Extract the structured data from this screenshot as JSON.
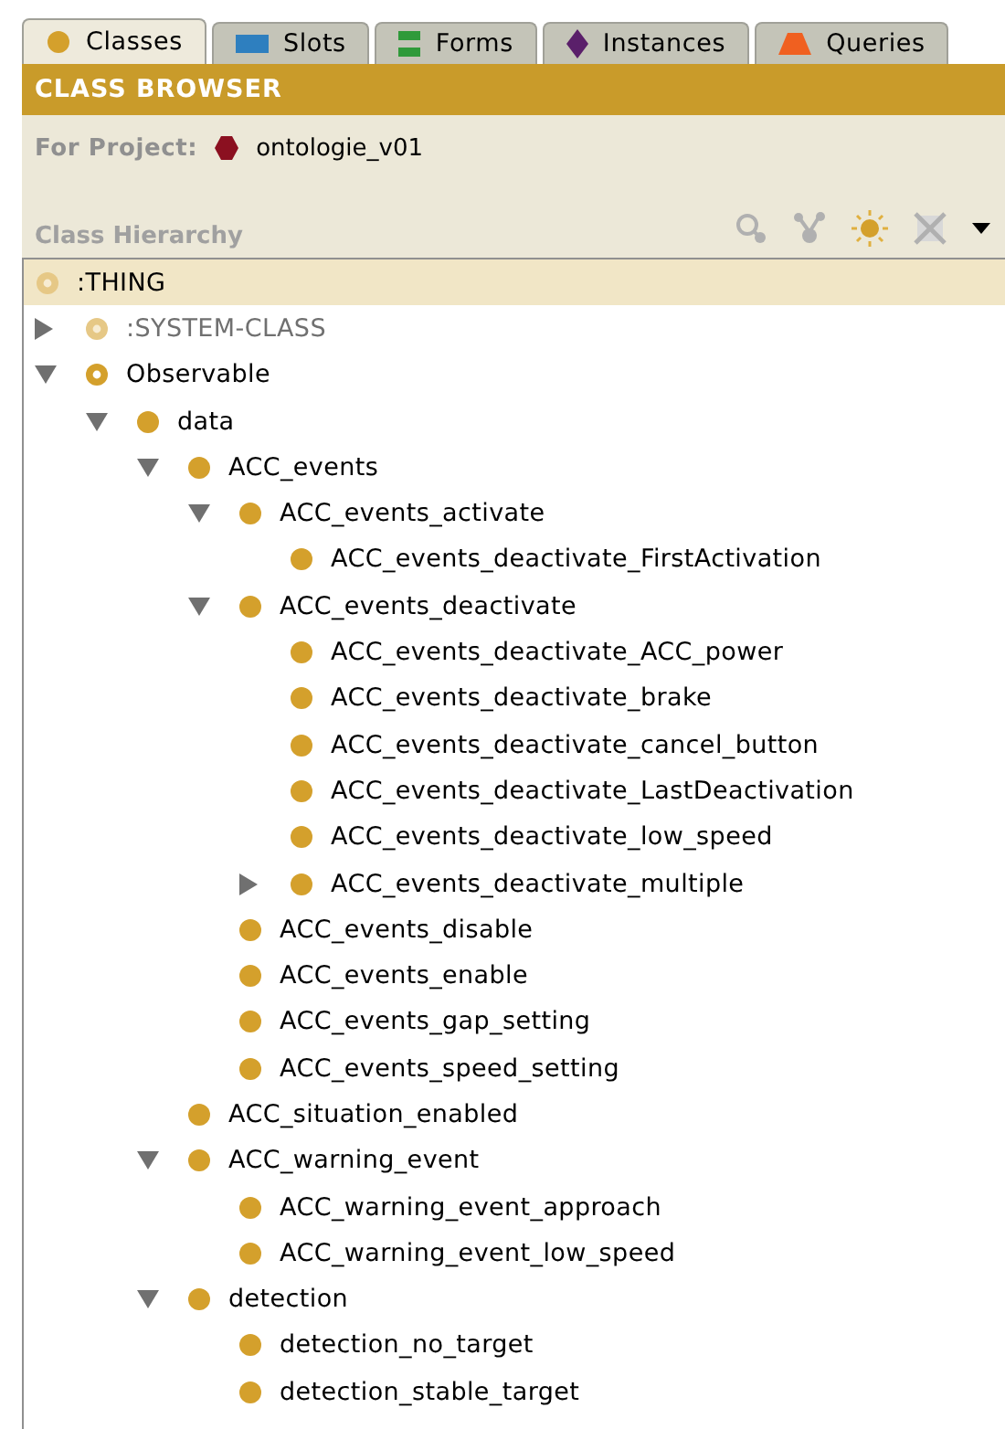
{
  "tabs": [
    {
      "label": "Classes",
      "kind": "class",
      "selected": true
    },
    {
      "label": "Slots",
      "kind": "slot",
      "selected": false
    },
    {
      "label": "Forms",
      "kind": "form",
      "selected": false
    },
    {
      "label": "Instances",
      "kind": "instance",
      "selected": false
    },
    {
      "label": "Queries",
      "kind": "query",
      "selected": false
    }
  ],
  "browser": {
    "title": "CLASS BROWSER",
    "project_label": "For Project:",
    "project_name": "ontologie_v01",
    "hierarchy_label": "Class Hierarchy"
  },
  "tree": {
    "root": {
      "label": ":THING",
      "kind": "pale",
      "selected": true,
      "children": [
        {
          "label": ":SYSTEM-CLASS",
          "kind": "system",
          "selected": false,
          "expanded": false
        },
        {
          "label": "Observable",
          "kind": "ring",
          "selected": false,
          "expanded": true,
          "children": [
            {
              "label": "data",
              "kind": "dot",
              "selected": false,
              "expanded": true,
              "children": [
                {
                  "label": "ACC_events",
                  "kind": "dot",
                  "selected": false,
                  "expanded": true,
                  "children": [
                    {
                      "label": "ACC_events_activate",
                      "kind": "dot",
                      "selected": false,
                      "expanded": true,
                      "children": [
                        {
                          "label": "ACC_events_deactivate_FirstActivation",
                          "kind": "dot",
                          "selected": false
                        }
                      ]
                    },
                    {
                      "label": "ACC_events_deactivate",
                      "kind": "dot",
                      "selected": false,
                      "expanded": true,
                      "children": [
                        {
                          "label": "ACC_events_deactivate_ACC_power",
                          "kind": "dot",
                          "selected": false
                        },
                        {
                          "label": "ACC_events_deactivate_brake",
                          "kind": "dot",
                          "selected": false
                        },
                        {
                          "label": "ACC_events_deactivate_cancel_button",
                          "kind": "dot",
                          "selected": false
                        },
                        {
                          "label": "ACC_events_deactivate_LastDeactivation",
                          "kind": "dot",
                          "selected": false
                        },
                        {
                          "label": "ACC_events_deactivate_low_speed",
                          "kind": "dot",
                          "selected": false
                        },
                        {
                          "label": "ACC_events_deactivate_multiple",
                          "kind": "dot",
                          "selected": false,
                          "expanded": false
                        }
                      ]
                    },
                    {
                      "label": "ACC_events_disable",
                      "kind": "dot",
                      "selected": false
                    },
                    {
                      "label": "ACC_events_enable",
                      "kind": "dot",
                      "selected": false
                    },
                    {
                      "label": "ACC_events_gap_setting",
                      "kind": "dot",
                      "selected": false
                    },
                    {
                      "label": "ACC_events_speed_setting",
                      "kind": "dot",
                      "selected": false
                    }
                  ]
                },
                {
                  "label": "ACC_situation_enabled",
                  "kind": "dot",
                  "selected": false
                },
                {
                  "label": "ACC_warning_event",
                  "kind": "dot",
                  "selected": false,
                  "expanded": true,
                  "children": [
                    {
                      "label": "ACC_warning_event_approach",
                      "kind": "dot",
                      "selected": false
                    },
                    {
                      "label": "ACC_warning_event_low_speed",
                      "kind": "dot",
                      "selected": false
                    }
                  ]
                },
                {
                  "label": "detection",
                  "kind": "dot",
                  "selected": false,
                  "expanded": true,
                  "children": [
                    {
                      "label": "detection_no_target",
                      "kind": "dot",
                      "selected": false
                    },
                    {
                      "label": "detection_stable_target",
                      "kind": "dot",
                      "selected": false
                    }
                  ]
                }
              ]
            }
          ]
        }
      ]
    }
  }
}
